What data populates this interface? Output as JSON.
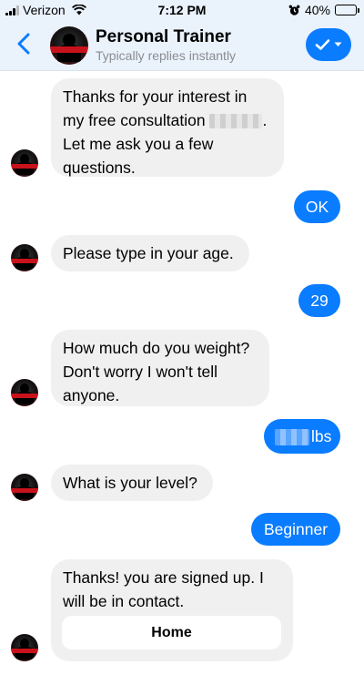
{
  "status_bar": {
    "carrier": "Verizon",
    "time": "7:12 PM",
    "battery": "40%",
    "battery_level": 0.4,
    "icons": [
      "signal-icon",
      "wifi-icon",
      "alarm-icon",
      "battery-icon"
    ]
  },
  "header": {
    "title": "Personal Trainer",
    "status": "Typically replies instantly",
    "back_icon": "chevron-left-icon",
    "action_icon": "checkmark-dropdown-icon",
    "accent_color": "#0a7cff"
  },
  "messages": [
    {
      "from": "them",
      "lines": [
        "Thanks for your interest in",
        "my free consultation",
        "Let me ask you a few",
        "questions."
      ]
    },
    {
      "from": "me",
      "text": "OK"
    },
    {
      "from": "them",
      "text": "Please type in your age."
    },
    {
      "from": "me",
      "text": "29"
    },
    {
      "from": "them",
      "lines": [
        "How much do you weight?",
        "Don't worry I won't tell",
        "anyone."
      ]
    },
    {
      "from": "me",
      "text": "lbs"
    },
    {
      "from": "them",
      "text": "What is your level?"
    },
    {
      "from": "me",
      "text": "Beginner"
    },
    {
      "from": "them",
      "lines": [
        "Thanks! you are signed up. I",
        "will be in contact."
      ],
      "button": "Home"
    }
  ]
}
